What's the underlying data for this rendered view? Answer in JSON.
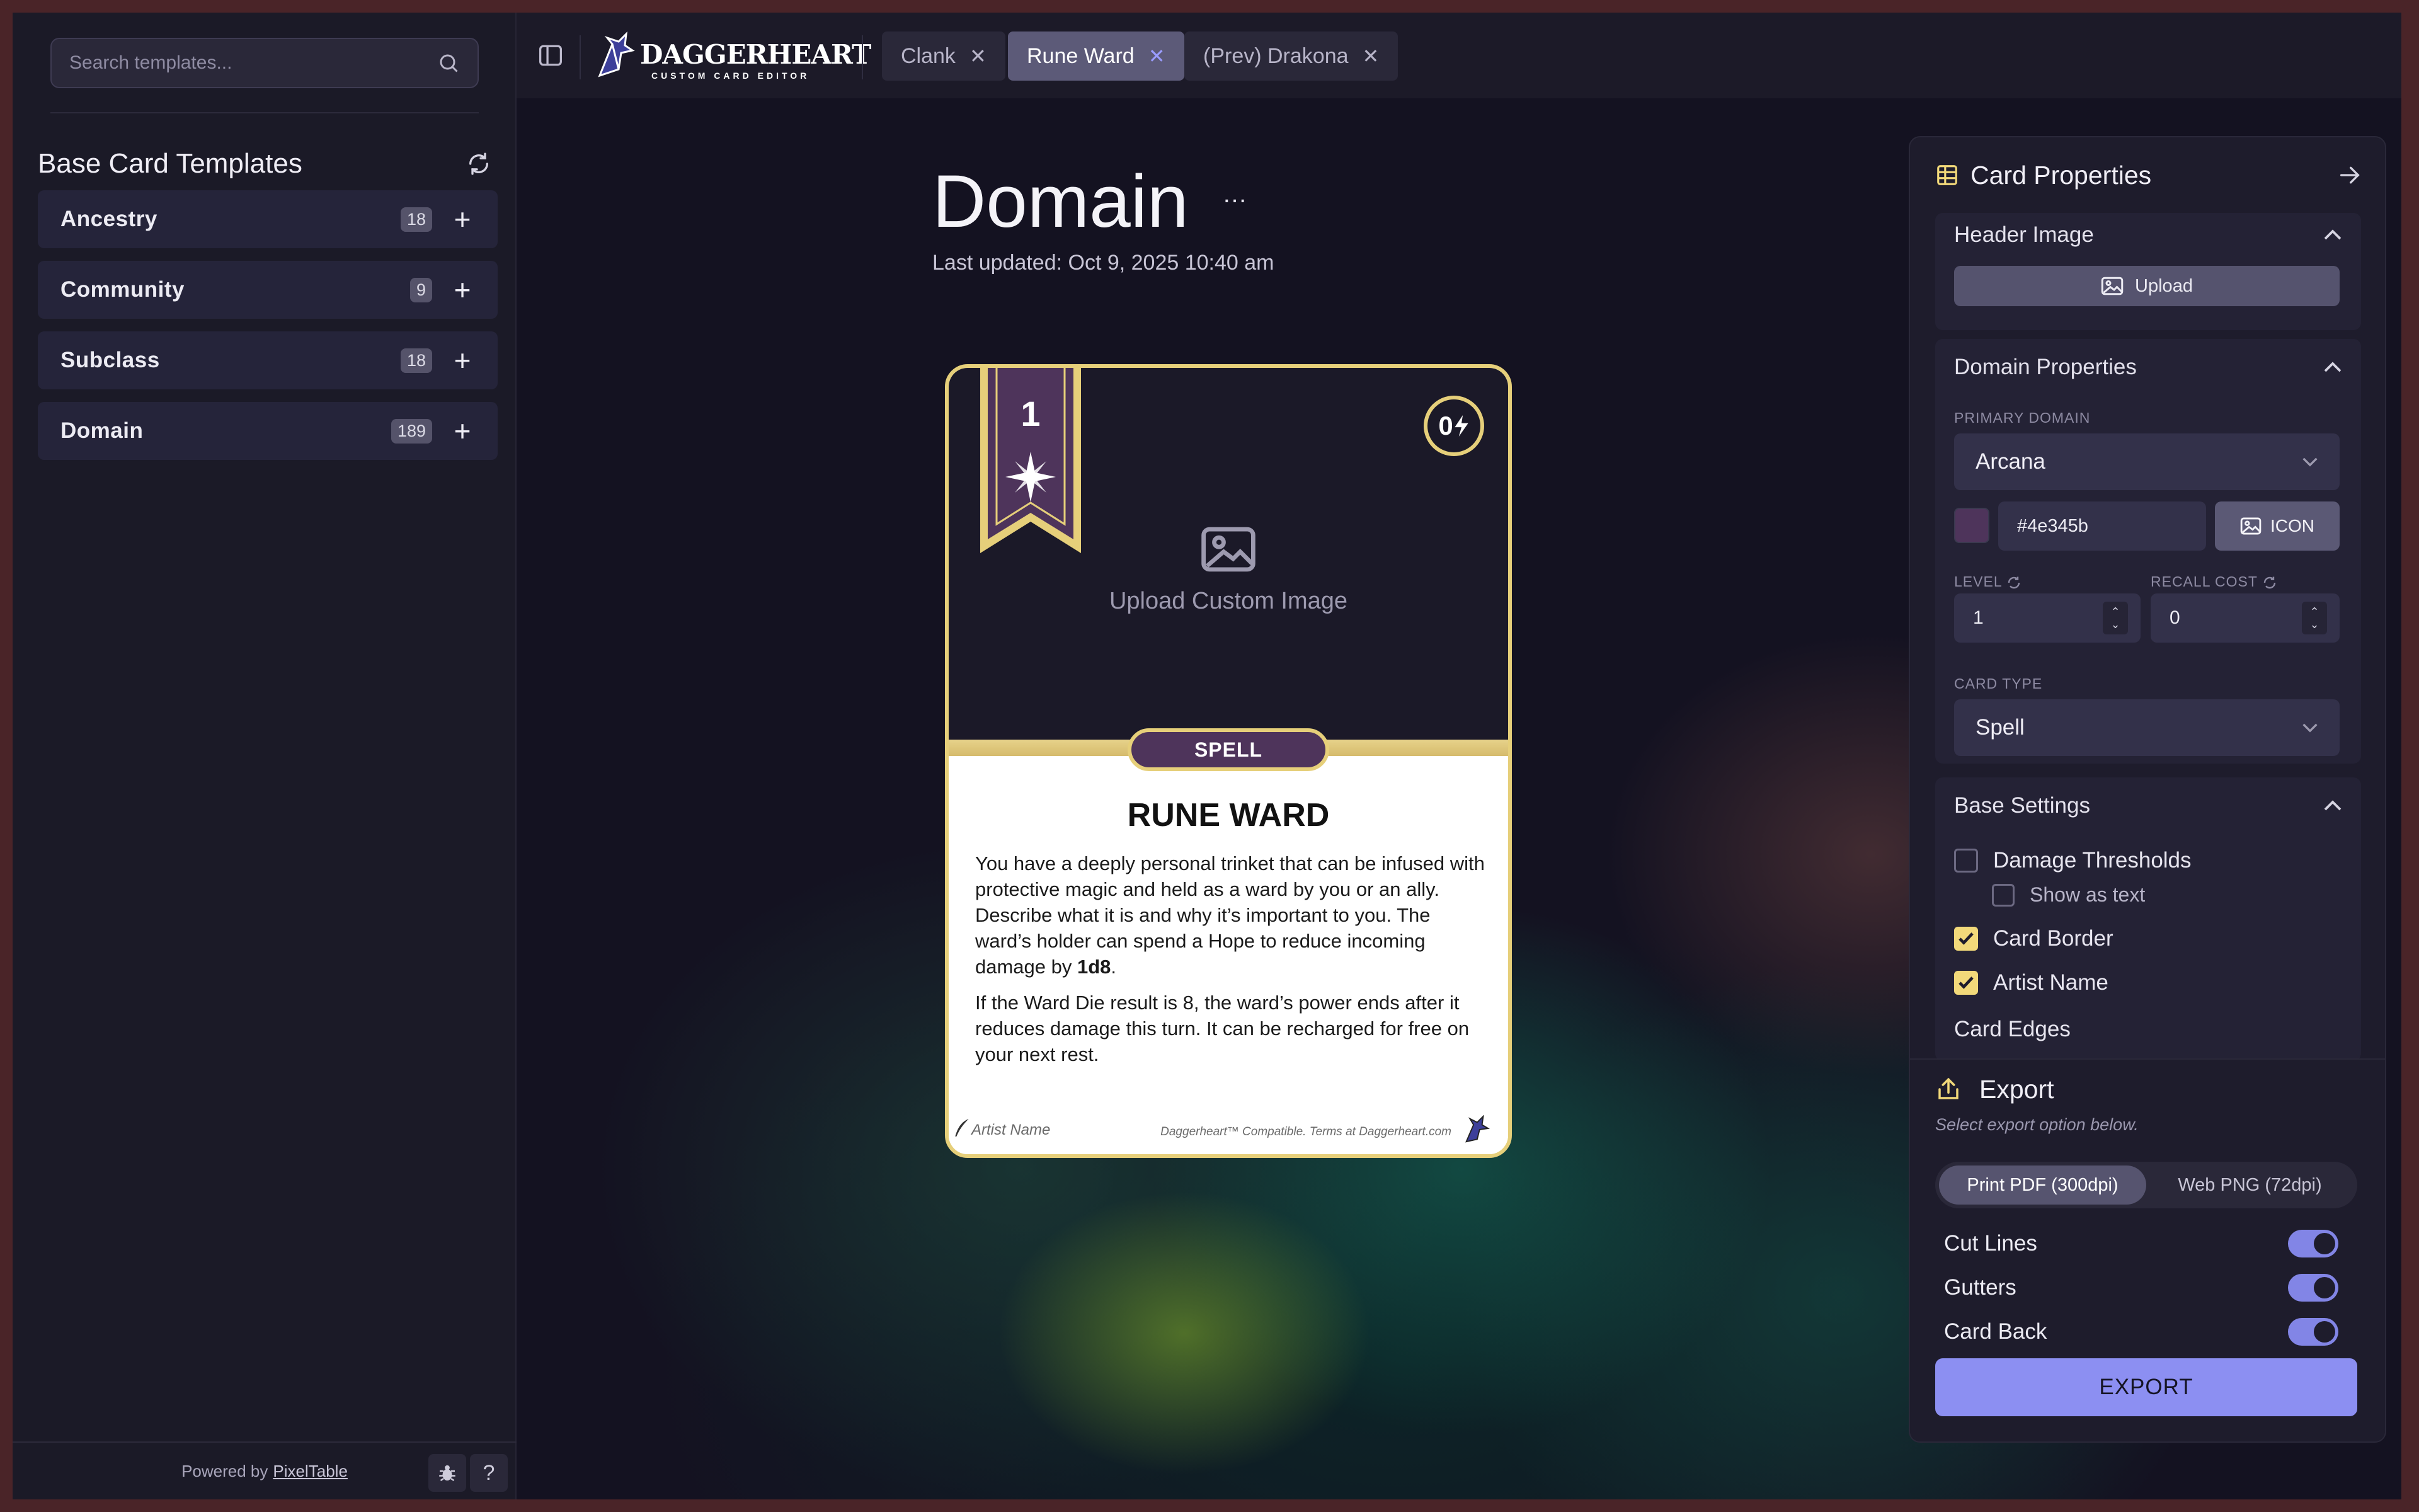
{
  "sidebar": {
    "search_placeholder": "Search templates...",
    "title": "Base Card Templates",
    "templates": [
      {
        "label": "Ancestry",
        "count": "18"
      },
      {
        "label": "Community",
        "count": "9"
      },
      {
        "label": "Subclass",
        "count": "18"
      },
      {
        "label": "Domain",
        "count": "189"
      }
    ],
    "footer_text": "Powered by",
    "footer_link": "PixelTable",
    "help_label": "?"
  },
  "topbar": {
    "logo_title": "DAGGERHEART",
    "logo_subtitle": "CUSTOM CARD EDITOR",
    "tabs": [
      {
        "label": "Clank",
        "active": false
      },
      {
        "label": "Rune Ward",
        "active": true
      },
      {
        "label": "(Prev) Drakona",
        "active": false
      }
    ]
  },
  "document": {
    "title": "Domain",
    "menu": "…",
    "last_updated": "Last updated: Oct 9, 2025 10:40 am"
  },
  "card": {
    "level": "1",
    "recall_cost": "0",
    "upload_label": "Upload Custom Image",
    "type": "SPELL",
    "name": "RUNE WARD",
    "text_p1": "You have a deeply personal trinket that can be infused with protective magic and held as a ward by you or an ally. Describe what it is and why it’s important to you. The ward’s holder can spend a Hope to reduce incoming damage by ",
    "text_p1_bold": "1d8",
    "text_p1_end": ".",
    "text_p2": "If the Ward Die result is 8, the ward’s power ends after it reduces damage this turn. It can be recharged for free on your next rest.",
    "artist": "Artist Name",
    "compat": "Daggerheart™ Compatible. Terms at Daggerheart.com",
    "banner_color": "#4e345b",
    "border_color": "#e6cf7a"
  },
  "properties": {
    "title": "Card Properties",
    "header_image": {
      "title": "Header Image",
      "upload_label": "Upload"
    },
    "domain": {
      "title": "Domain Properties",
      "primary_label": "PRIMARY DOMAIN",
      "primary_value": "Arcana",
      "color_hex": "#4e345b",
      "icon_label": "ICON",
      "level_label": "LEVEL",
      "level_value": "1",
      "recall_label": "RECALL COST",
      "recall_value": "0",
      "type_label": "CARD TYPE",
      "type_value": "Spell"
    },
    "base": {
      "title": "Base Settings",
      "damage_thresholds": "Damage Thresholds",
      "show_as_text": "Show as text",
      "card_border": "Card Border",
      "artist_name": "Artist Name",
      "card_edges": "Card Edges"
    },
    "export": {
      "title": "Export",
      "subtitle": "Select export option below.",
      "option_pdf": "Print PDF (300dpi)",
      "option_png": "Web PNG (72dpi)",
      "cut_lines": "Cut Lines",
      "gutters": "Gutters",
      "card_back": "Card Back",
      "button": "EXPORT"
    }
  },
  "colors": {
    "accent": "#8c8ff2",
    "checkbox": "#f2d97a",
    "domain": "#4e345b"
  }
}
